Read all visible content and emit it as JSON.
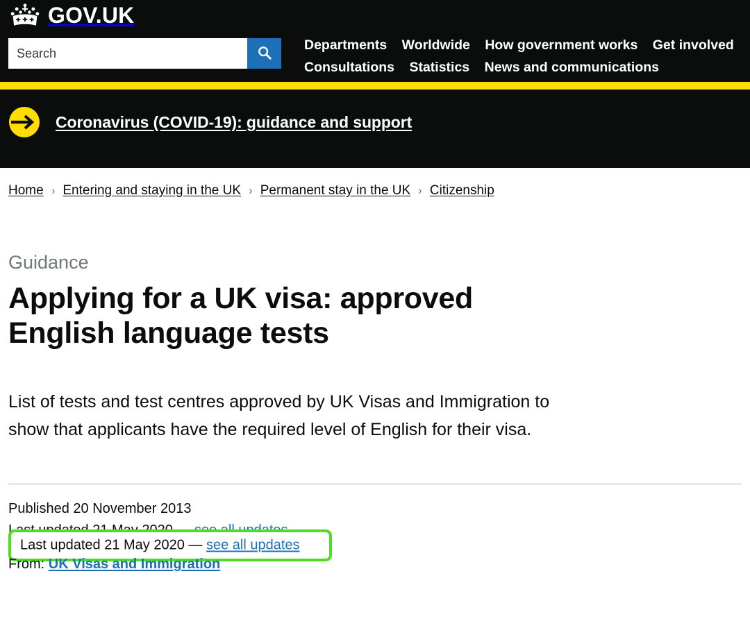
{
  "header": {
    "brand": "GOV.UK",
    "crown_icon": "crown-icon",
    "search": {
      "placeholder": "Search",
      "value": "",
      "button_icon": "search-icon"
    },
    "nav": {
      "row1": [
        "Departments",
        "Worldwide",
        "How government works",
        "Get involved"
      ],
      "row2": [
        "Consultations",
        "Statistics",
        "News and communications"
      ]
    },
    "accent_yellow": "#ffdd00",
    "background": "#0b0c0c",
    "search_button_blue": "#1d70b8"
  },
  "covid_banner": {
    "icon": "arrow-right-circle-icon",
    "link_text": "Coronavirus (COVID-19): guidance and support"
  },
  "breadcrumbs": {
    "separator": "›",
    "items": [
      "Home",
      "Entering and staying in the UK",
      "Permanent stay in the UK",
      "Citizenship"
    ]
  },
  "document": {
    "type_label": "Guidance",
    "title": "Applying for a UK visa: approved English language tests",
    "description": "List of tests and test centres approved by UK Visas and Immigration to show that applicants have the required level of English for their visa."
  },
  "metadata": {
    "published_label": "Published",
    "published_date": "20 November 2013",
    "published_line": "Published 20 November 2013",
    "last_updated_prefix": "Last updated",
    "last_updated_date": "21 May 2020",
    "last_updated_separator": "—",
    "see_all_updates_link": "see all updates",
    "last_updated_line_prefix": "Last updated 21 May 2020 — ",
    "from_label": "From:",
    "from_org": "UK Visas and Immigration",
    "link_blue": "#1d70b8"
  },
  "annotation": {
    "highlight_color": "#4ddd23",
    "target": "last-updated-line"
  }
}
